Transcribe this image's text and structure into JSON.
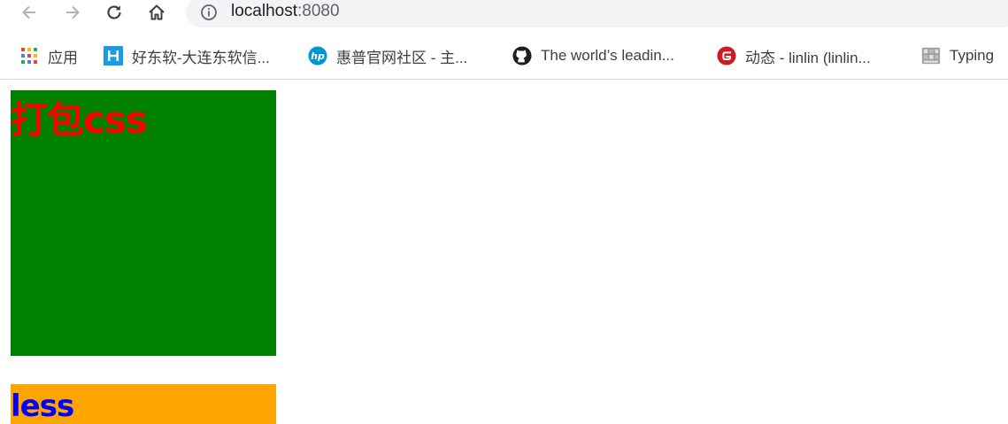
{
  "browser": {
    "url_host": "localhost",
    "url_port": ":8080",
    "icons": [
      "back-icon",
      "forward-icon",
      "reload-icon",
      "home-icon",
      "info-icon"
    ]
  },
  "bookmarks": [
    {
      "label": "应用",
      "icon": "apps-grid-icon"
    },
    {
      "label": "好东软-大连东软信...",
      "icon": "neusoft-icon"
    },
    {
      "label": "惠普官网社区 - 主...",
      "icon": "hp-icon"
    },
    {
      "label": "The world’s leadin...",
      "icon": "github-icon"
    },
    {
      "label": "动态 - linlin (linlin...",
      "icon": "gitee-icon"
    },
    {
      "label": "Typing",
      "icon": "typing-icon"
    }
  ],
  "page": {
    "heading": "打包css",
    "subheading": "less",
    "colors": {
      "box_background": "#008000",
      "heading_color": "#ff0000",
      "less_background": "#ffa500",
      "less_color": "#0000ff"
    }
  }
}
